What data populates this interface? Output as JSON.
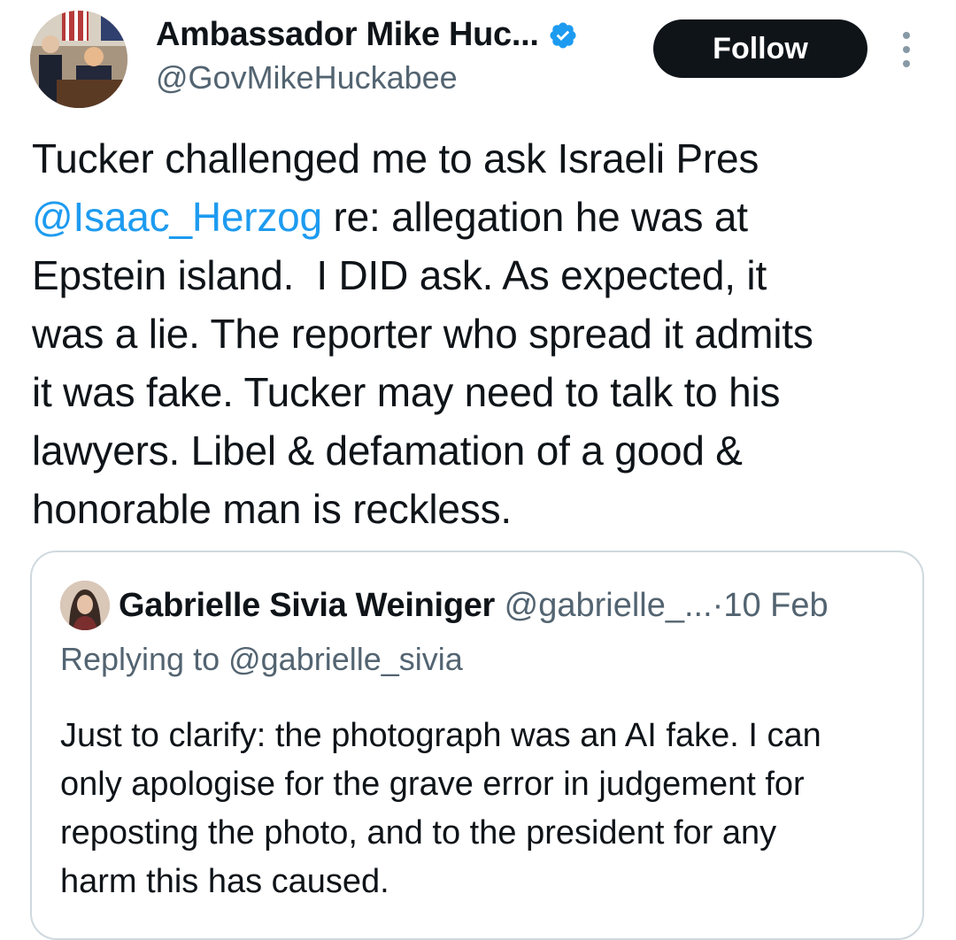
{
  "author": {
    "display_name": "Ambassador Mike Huc...",
    "handle": "@GovMikeHuckabee",
    "verified": true,
    "verified_color": "#1d9bf0"
  },
  "actions": {
    "follow_label": "Follow",
    "more_icon": "more-vertical-icon"
  },
  "tweet": {
    "lines": [
      "Tucker challenged me to ask Israeli Pres",
      "re: allegation he was at",
      "Epstein island.  I DID ask. As expected, it",
      "was a lie. The reporter who spread it admits",
      "it was fake. Tucker may need to talk to his",
      "lawyers. Libel & defamation of a good &",
      "honorable man is reckless."
    ],
    "mention": "@Isaac_Herzog",
    "mention_color": "#1d9bf0"
  },
  "quoted_tweet": {
    "display_name": "Gabrielle Sivia Weiniger",
    "handle": "@gabrielle_...",
    "separator": "·",
    "date": "10 Feb",
    "replying_to": "Replying to @gabrielle_sivia",
    "lines": [
      "Just to clarify: the photograph was an AI fake. I can",
      "only apologise for the grave error in judgement for",
      "reposting the photo, and to the president for any",
      "harm this has caused."
    ]
  },
  "colors": {
    "text_primary": "#0f1419",
    "text_secondary": "#536471",
    "border": "#cfd9de",
    "button_bg": "#0f1419"
  }
}
